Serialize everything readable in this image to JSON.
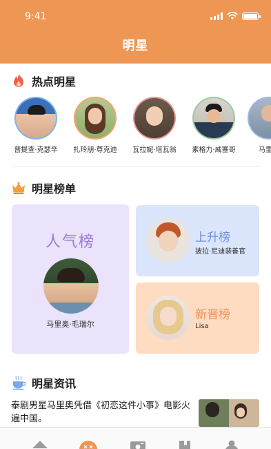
{
  "status_bar": {
    "time": "9:41"
  },
  "header": {
    "title": "明星"
  },
  "hot_section": {
    "title": "热点明星",
    "icon": "flame-icon",
    "stars": [
      {
        "name": "普提查·克瑟辛"
      },
      {
        "name": "扎玲朋·尊克迪"
      },
      {
        "name": "瓦拉妮·塔瓦翁"
      },
      {
        "name": "素格力·威塞哥"
      },
      {
        "name": "马里奥"
      }
    ]
  },
  "ranking_section": {
    "title": "明星榜单",
    "icon": "crown-icon",
    "popular": {
      "title": "人气榜",
      "name": "马里奥·毛瑞尔"
    },
    "rising": {
      "title": "上升榜",
      "name": "披拉·尼迪裴善官"
    },
    "newcomer": {
      "title": "新晋榜",
      "name": "Lisa"
    }
  },
  "news_section": {
    "title": "明星资讯",
    "icon": "coffee-cup-icon",
    "items": [
      {
        "text": "泰剧男星马里奥凭借《初恋这件小事》电影火遍中国。"
      }
    ]
  },
  "tabbar": {
    "tabs": [
      {
        "icon": "home-icon"
      },
      {
        "icon": "star-logo-icon"
      },
      {
        "icon": "camera-icon"
      },
      {
        "icon": "book-icon"
      },
      {
        "icon": "profile-icon"
      }
    ]
  },
  "colors": {
    "header": "#ee9654",
    "popular_card": "#ebe2fb",
    "rising_card": "#dbe5fc",
    "newcomer_card": "#fddcc2"
  }
}
